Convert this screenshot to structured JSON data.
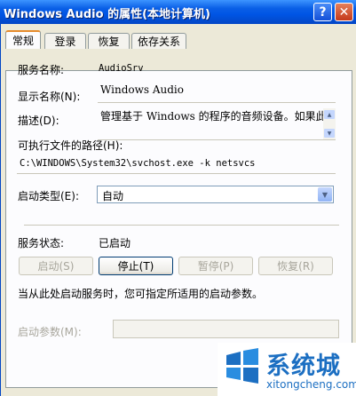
{
  "window": {
    "title": "Windows Audio 的属性(本地计算机)",
    "help": "?",
    "close": "✕"
  },
  "tabs": [
    "常规",
    "登录",
    "恢复",
    "依存关系"
  ],
  "general": {
    "service_name_label": "服务名称:",
    "service_name": "AudioSrv",
    "display_name_label": "显示名称(N):",
    "display_name": "Windows Audio",
    "description_label": "描述(D):",
    "description": "管理基于 Windows 的程序的音频设备。如果此",
    "path_label": "可执行文件的路径(H):",
    "path": "C:\\WINDOWS\\System32\\svchost.exe -k netsvcs",
    "startup_type_label": "启动类型(E):",
    "startup_type": "自动",
    "status_label": "服务状态:",
    "status": "已启动",
    "buttons": {
      "start": "启动(S)",
      "stop": "停止(T)",
      "pause": "暂停(P)",
      "resume": "恢复(R)"
    },
    "hint": "当从此处启动服务时，您可指定所适用的启动参数。",
    "params_label": "启动参数(M):"
  },
  "watermark": {
    "text": "系统城",
    "url": "xitongcheng.com"
  }
}
